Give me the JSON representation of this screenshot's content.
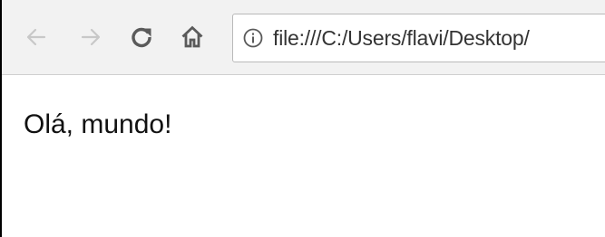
{
  "browser": {
    "url": "file:///C:/Users/flavi/Desktop/",
    "back_icon": "back-arrow-icon",
    "forward_icon": "forward-arrow-icon",
    "reload_icon": "reload-icon",
    "home_icon": "home-icon",
    "info_icon": "info-icon"
  },
  "page": {
    "text": "Olá, mundo!"
  }
}
